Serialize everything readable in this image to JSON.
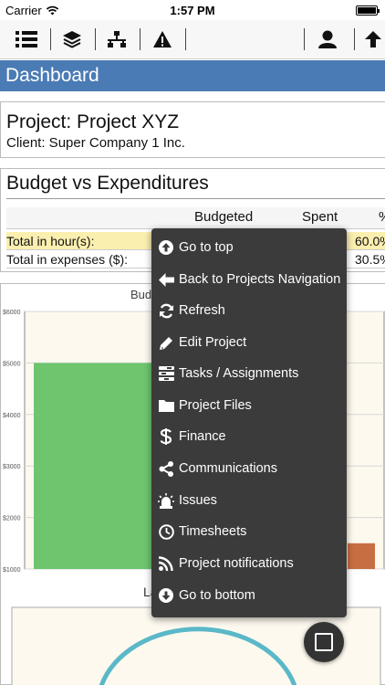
{
  "status_bar": {
    "carrier": "Carrier",
    "time": "1:57 PM"
  },
  "toolbar": {
    "icons": [
      "list-icon",
      "layers-icon",
      "network-icon",
      "alert-icon",
      "user-icon",
      "upload-icon"
    ]
  },
  "header": {
    "title": "Dashboard"
  },
  "project": {
    "title": "Project: Project XYZ",
    "client": "Client: Super Company 1 Inc."
  },
  "budget": {
    "title": "Budget vs Expenditures",
    "columns": [
      "Budgeted",
      "Spent",
      "%"
    ],
    "rows": [
      {
        "label": "Total in hour(s):",
        "percent": "60.0%"
      },
      {
        "label": "Total in expenses ($):",
        "percent": "30.5%"
      }
    ]
  },
  "chart": {
    "title_partial": "Bud",
    "lower_label_partial": "La"
  },
  "chart_data": {
    "type": "bar",
    "title": "Bud",
    "y_ticks": [
      "$6000",
      "$5000",
      "$4000",
      "$3000",
      "$2000",
      "$1000"
    ],
    "ylim": [
      1000,
      6000
    ],
    "series": [
      {
        "values": [
          5000
        ],
        "color": "#6ec56e"
      },
      {
        "values": [
          1500
        ],
        "color": "#c86e43"
      }
    ],
    "grid": true
  },
  "menu": {
    "items": [
      {
        "label": "Go to top",
        "icon": "arrow-up-circle-icon"
      },
      {
        "label": "Back to Projects Navigation",
        "icon": "arrow-left-icon"
      },
      {
        "label": "Refresh",
        "icon": "refresh-icon"
      },
      {
        "label": "Edit Project",
        "icon": "pencil-icon"
      },
      {
        "label": "Tasks / Assignments",
        "icon": "tasks-icon"
      },
      {
        "label": "Project Files",
        "icon": "folder-icon"
      },
      {
        "label": "Finance",
        "icon": "dollar-icon"
      },
      {
        "label": "Communications",
        "icon": "share-icon"
      },
      {
        "label": "Issues",
        "icon": "siren-icon"
      },
      {
        "label": "Timesheets",
        "icon": "clock-icon"
      },
      {
        "label": "Project notifications",
        "icon": "rss-icon"
      },
      {
        "label": "Go to bottom",
        "icon": "arrow-down-circle-icon"
      }
    ]
  },
  "colors": {
    "header_bg": "#4a7bb5",
    "menu_bg": "#3b3b3b",
    "highlight_row": "#fbefb0",
    "bar_green": "#6ec56e",
    "bar_orange": "#c86e43",
    "chart_bg": "#fdf9ef"
  }
}
